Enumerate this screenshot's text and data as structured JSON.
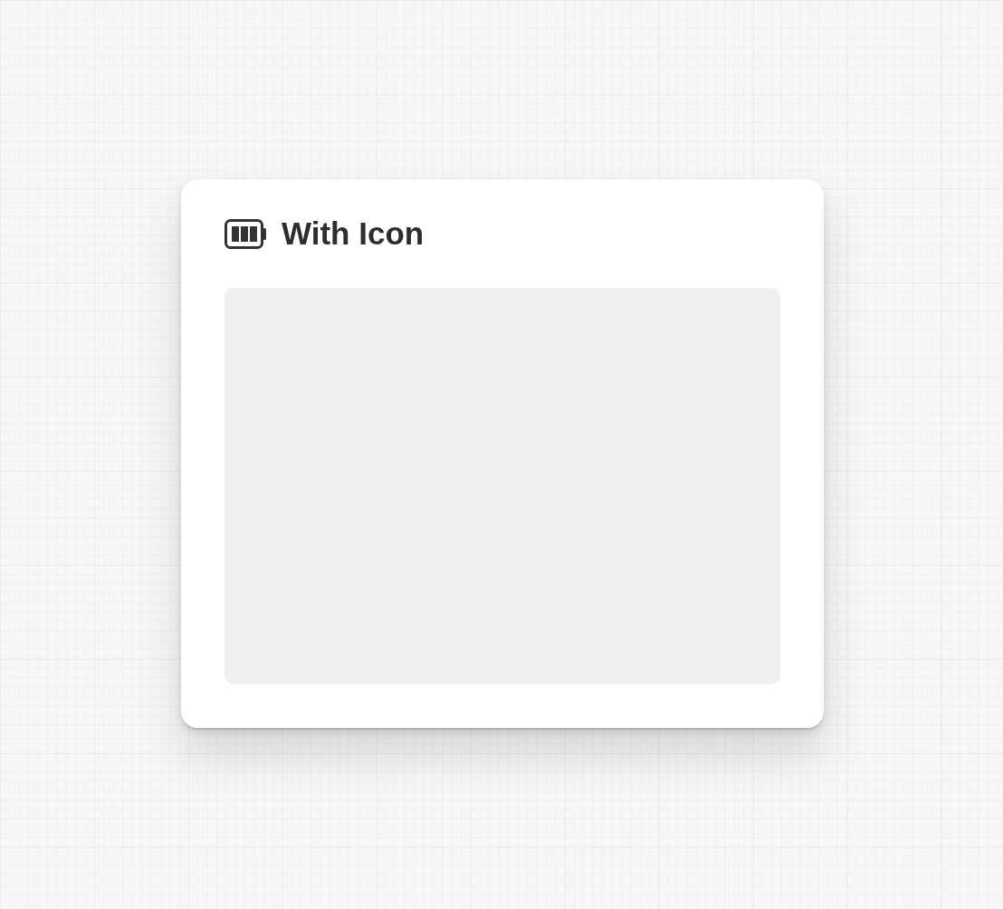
{
  "card": {
    "title": "With Icon"
  }
}
